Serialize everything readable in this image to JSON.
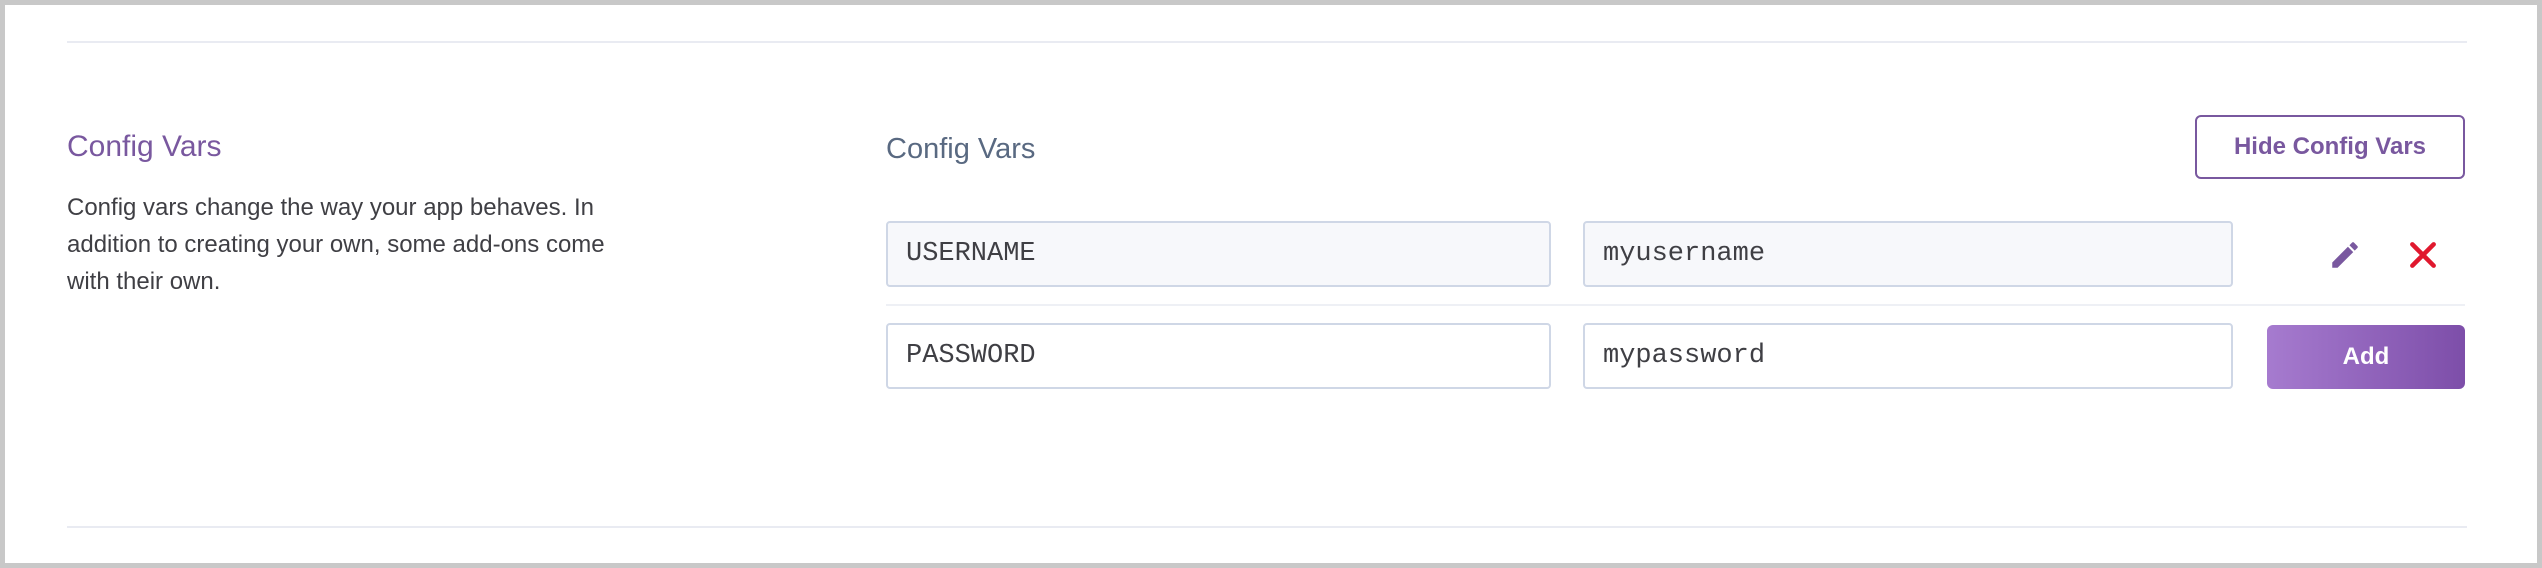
{
  "section": {
    "title": "Config Vars",
    "description": "Config vars change the way your app behaves. In addition to creating your own, some add-ons come with their own."
  },
  "panel": {
    "title": "Config Vars",
    "hide_button_label": "Hide Config Vars"
  },
  "config_vars": [
    {
      "key": "USERNAME",
      "value": "myusername"
    }
  ],
  "new_var": {
    "key": "PASSWORD",
    "value": "mypassword",
    "add_label": "Add"
  },
  "icons": {
    "edit": "pencil-icon",
    "delete": "close-icon"
  },
  "colors": {
    "accent": "#79589f",
    "delete": "#e0182e",
    "add_gradient_start": "#a67bcf",
    "add_gradient_end": "#7d4ea9"
  }
}
